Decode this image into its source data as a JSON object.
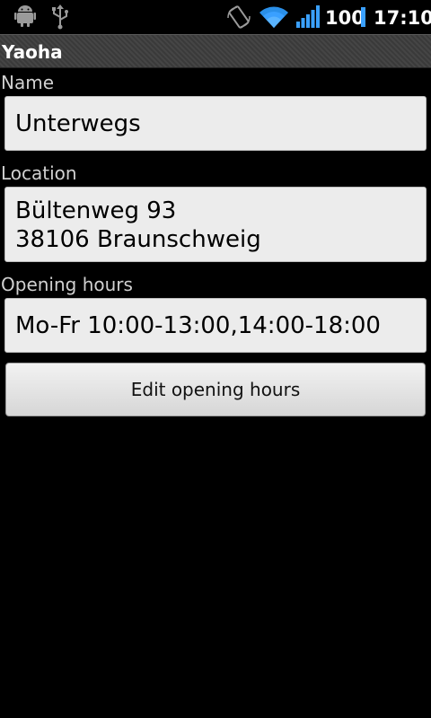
{
  "status_bar": {
    "icons": [
      "android-icon",
      "usb-icon",
      "auto-rotate-icon",
      "wifi-icon",
      "signal-icon"
    ],
    "battery": "100",
    "time": "17:10",
    "accent": "#3aa0ff"
  },
  "app": {
    "title": "Yaoha"
  },
  "form": {
    "name_label": "Name",
    "name_value": "Unterwegs",
    "location_label": "Location",
    "location_line1": "Bültenweg 93",
    "location_line2": "38106 Braunschweig",
    "hours_label": "Opening hours",
    "hours_value": "Mo-Fr 10:00-13:00,14:00-18:00",
    "edit_button": "Edit opening hours"
  }
}
